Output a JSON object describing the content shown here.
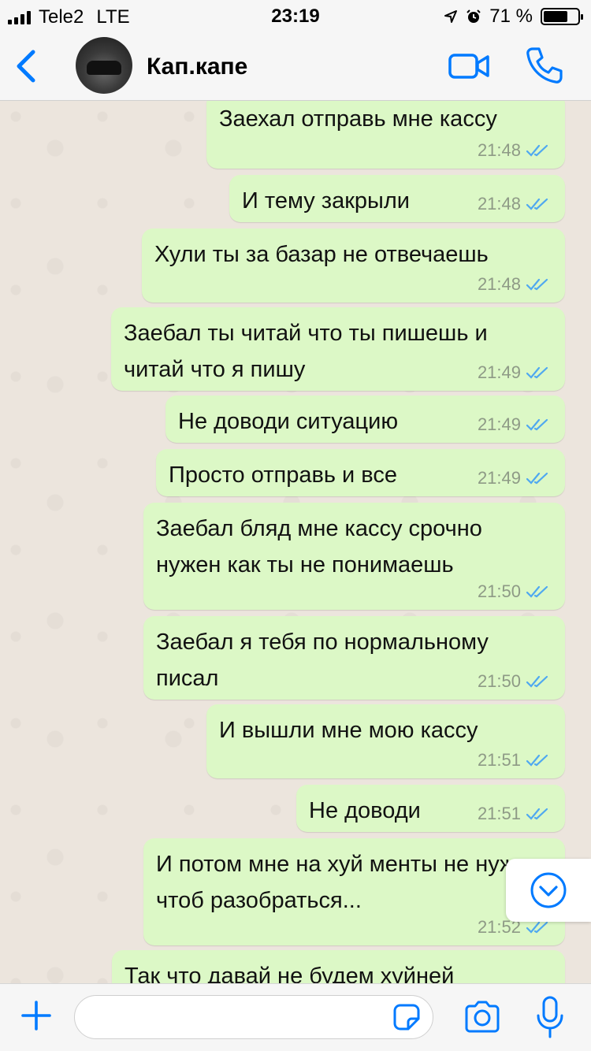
{
  "status_bar": {
    "carrier": "Tele2",
    "network": "LTE",
    "time": "23:19",
    "battery_text": "71 %",
    "battery_level": 0.71
  },
  "header": {
    "contact_name": "Кап.капе"
  },
  "messages": [
    {
      "text": "Заехал отправь мне кассу",
      "time": "21:48"
    },
    {
      "text": "И тему закрыли",
      "time": "21:48"
    },
    {
      "text": "Хули ты за базар не отвечаешь",
      "time": "21:48"
    },
    {
      "text": "Заебал ты читай что ты пишешь и читай что я пишу",
      "time": "21:49"
    },
    {
      "text": "Не доводи ситуацию",
      "time": "21:49"
    },
    {
      "text": "Просто отправь и все",
      "time": "21:49"
    },
    {
      "text": "Заебал бляд мне кассу срочно нужен как ты не понимаешь",
      "time": "21:50"
    },
    {
      "text": "Заебал я тебя по нормальному писал",
      "time": "21:50"
    },
    {
      "text": "И вышли мне мою кассу",
      "time": "21:51"
    },
    {
      "text": "Не доводи",
      "time": "21:51"
    },
    {
      "text": "И потом мне на хуй менты не нужны чтоб разобраться...",
      "time": "21:52"
    },
    {
      "text": "Так что давай не будем хуйней",
      "time": ""
    }
  ],
  "colors": {
    "accent": "#007aff",
    "outgoing_bubble": "#dcf8c6",
    "read_ticks": "#4fa8f0"
  },
  "icons": {
    "back": "chevron-left-icon",
    "video": "video-camera-icon",
    "call": "phone-icon",
    "scroll_down": "chevron-down-circle-icon",
    "plus": "plus-icon",
    "sticker": "sticker-icon",
    "camera": "camera-icon",
    "mic": "microphone-icon"
  }
}
